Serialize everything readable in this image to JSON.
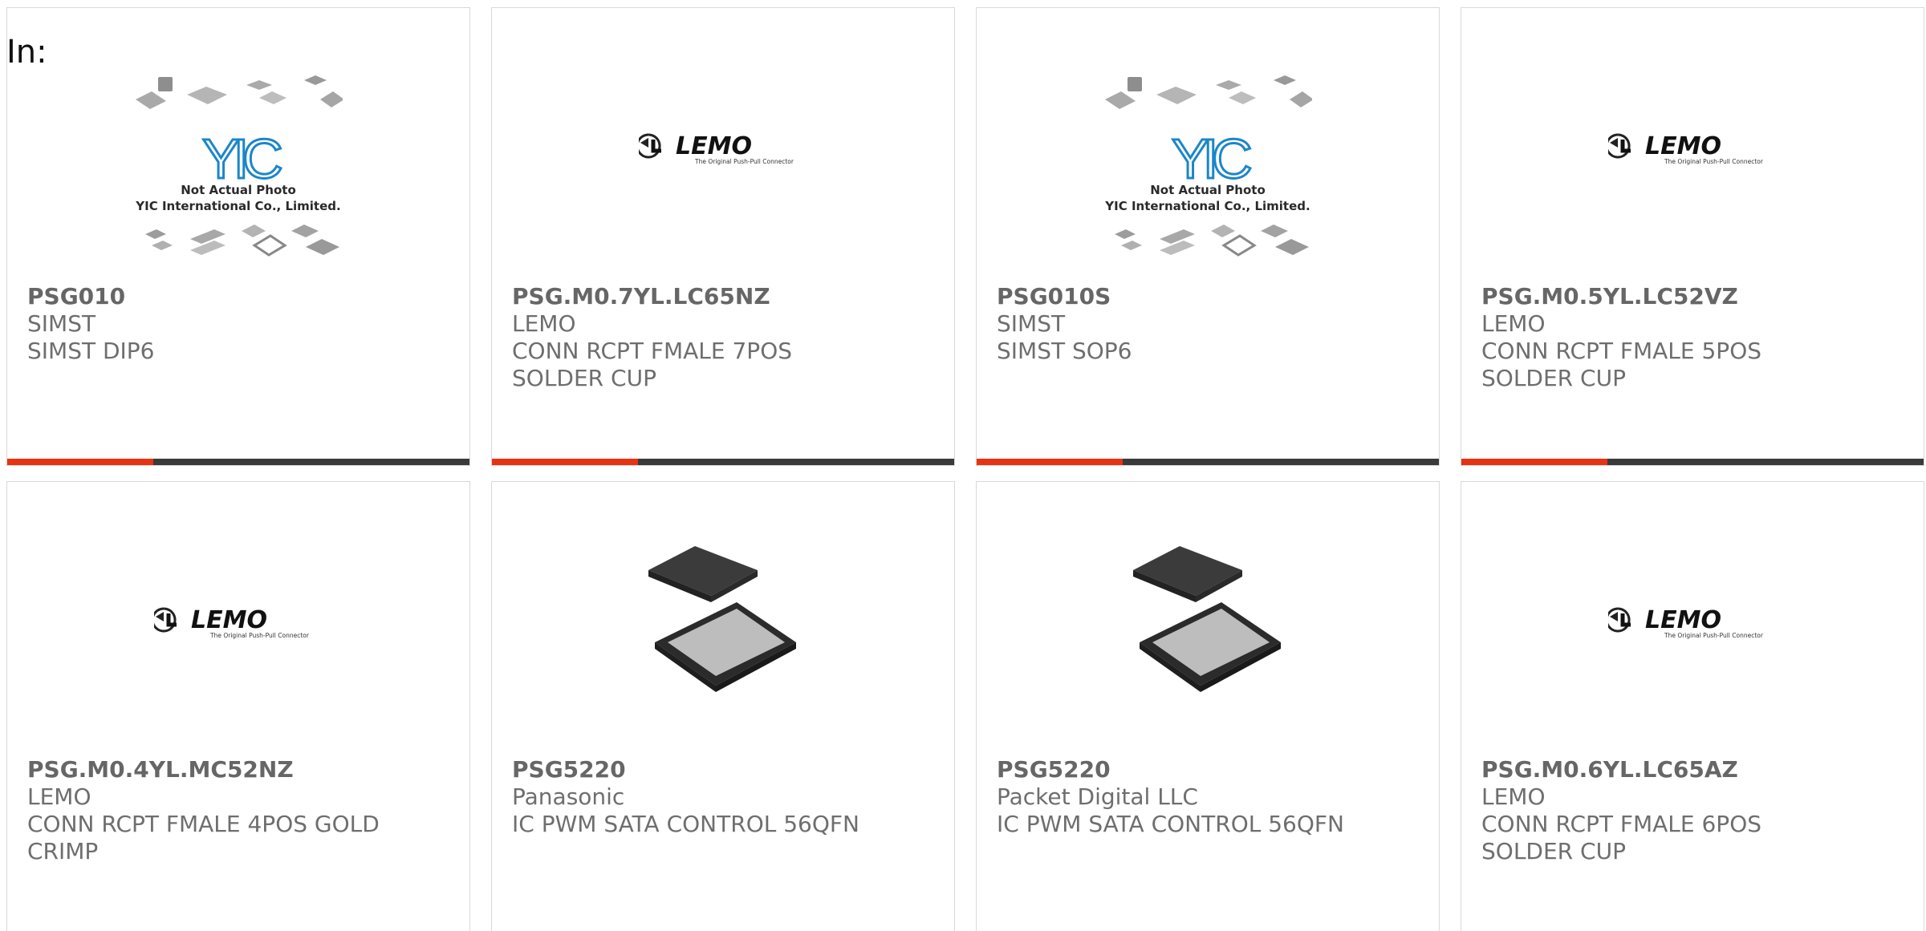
{
  "filter_label": "In:",
  "placeholder_image": {
    "line1": "Not Actual Photo",
    "line2": "YIC International Co., Limited.",
    "logo": "YIC"
  },
  "lemo_logo": {
    "word": "LEMO",
    "tagline": "The Original Push-Pull Connector"
  },
  "products": [
    {
      "part": "PSG010",
      "maker": "SIMST",
      "desc1": "SIMST DIP6",
      "desc2": "",
      "image": "yic-placeholder"
    },
    {
      "part": "PSG.M0.7YL.LC65NZ",
      "maker": "LEMO",
      "desc1": "CONN RCPT FMALE 7POS",
      "desc2": "SOLDER CUP",
      "image": "lemo-logo"
    },
    {
      "part": "PSG010S",
      "maker": "SIMST",
      "desc1": "SIMST SOP6",
      "desc2": "",
      "image": "yic-placeholder"
    },
    {
      "part": "PSG.M0.5YL.LC52VZ",
      "maker": "LEMO",
      "desc1": "CONN RCPT FMALE 5POS",
      "desc2": "SOLDER CUP",
      "image": "lemo-logo"
    },
    {
      "part": "PSG.M0.4YL.MC52NZ",
      "maker": "LEMO",
      "desc1": "CONN RCPT FMALE 4POS GOLD",
      "desc2": "CRIMP",
      "image": "lemo-logo"
    },
    {
      "part": "PSG5220",
      "maker": "Panasonic",
      "desc1": "IC PWM SATA CONTROL 56QFN",
      "desc2": "",
      "image": "qfn-chip"
    },
    {
      "part": "PSG5220",
      "maker": "Packet Digital LLC",
      "desc1": "IC PWM SATA CONTROL 56QFN",
      "desc2": "",
      "image": "qfn-chip"
    },
    {
      "part": "PSG.M0.6YL.LC65AZ",
      "maker": "LEMO",
      "desc1": "CONN RCPT FMALE 6POS",
      "desc2": "SOLDER CUP",
      "image": "lemo-logo"
    }
  ],
  "colors": {
    "accent": "#e63312",
    "bar": "#3a3a3a",
    "text": "#6e6e6e",
    "yic_blue": "#1b86c9"
  }
}
